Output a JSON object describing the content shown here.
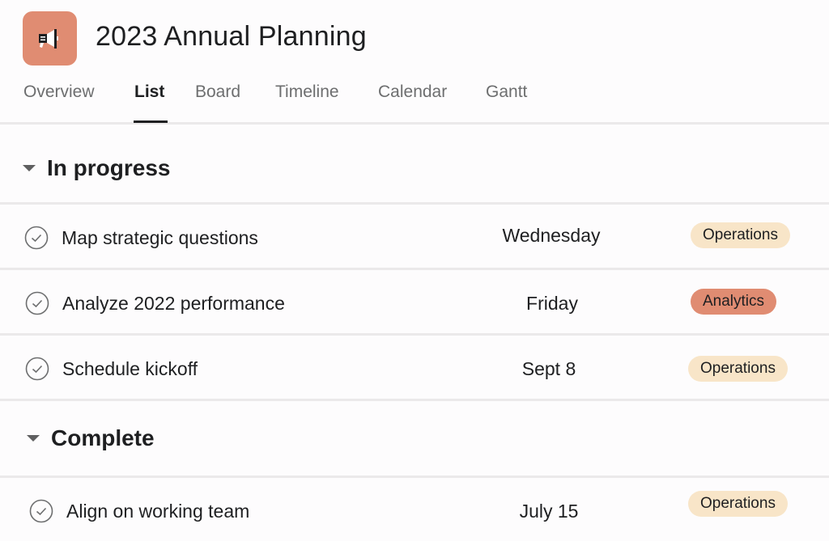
{
  "project": {
    "title": "2023 Annual Planning",
    "icon": "megaphone-icon",
    "icon_color": "#e08c72"
  },
  "tabs": [
    {
      "label": "Overview",
      "active": false
    },
    {
      "label": "List",
      "active": true
    },
    {
      "label": "Board",
      "active": false
    },
    {
      "label": "Timeline",
      "active": false
    },
    {
      "label": "Calendar",
      "active": false
    },
    {
      "label": "Gantt",
      "active": false
    }
  ],
  "sections": [
    {
      "title": "In progress",
      "tasks": [
        {
          "name": "Map strategic questions",
          "due": "Wednesday",
          "tag": "Operations",
          "tag_color": "#f8e5c8"
        },
        {
          "name": "Analyze 2022 performance",
          "due": "Friday",
          "tag": "Analytics",
          "tag_color": "#e08c72"
        },
        {
          "name": "Schedule kickoff",
          "due": "Sept 8",
          "tag": "Operations",
          "tag_color": "#f8e5c8"
        }
      ]
    },
    {
      "title": "Complete",
      "tasks": [
        {
          "name": "Align on working team",
          "due": "July 15",
          "tag": "Operations",
          "tag_color": "#f8e5c8"
        }
      ]
    }
  ]
}
